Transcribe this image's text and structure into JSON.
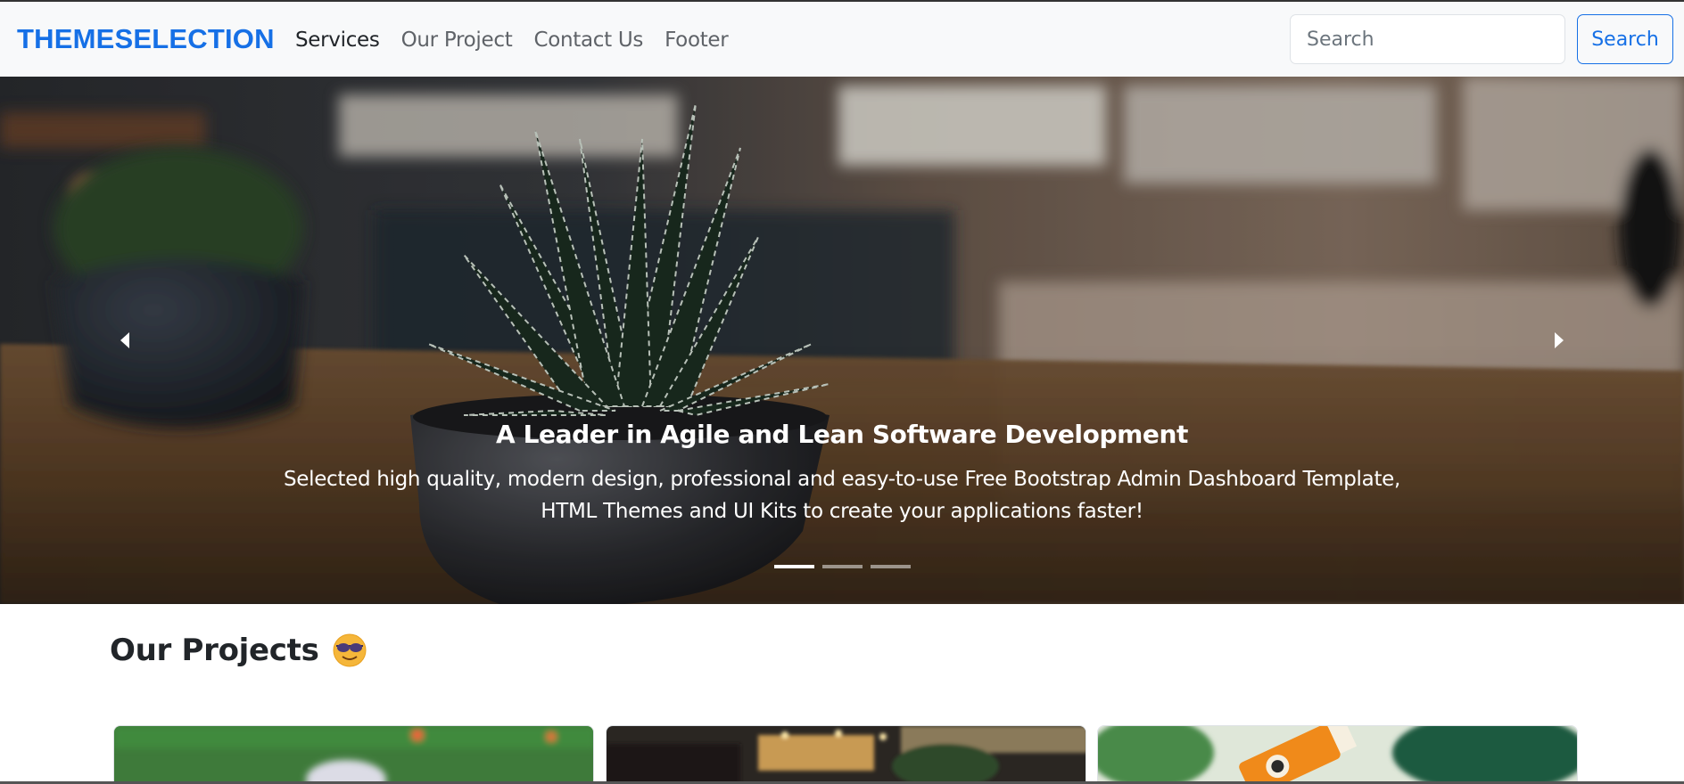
{
  "navbar": {
    "brand": "THEMESELECTION",
    "links": [
      {
        "label": "Services",
        "active": true
      },
      {
        "label": "Our Project",
        "active": false
      },
      {
        "label": "Contact Us",
        "active": false
      },
      {
        "label": "Footer",
        "active": false
      }
    ],
    "search": {
      "placeholder": "Search",
      "value": "",
      "button_label": "Search"
    }
  },
  "carousel": {
    "caption_title": "A Leader in Agile and Lean Software Development",
    "caption_text": "Selected high quality, modern design, professional and easy-to-use Free Bootstrap Admin Dashboard Template, HTML Themes and UI Kits to create your applications faster!",
    "slide_count": 3,
    "active_index": 0,
    "prev_icon": "caret-left-icon",
    "next_icon": "caret-right-icon"
  },
  "projects": {
    "title": "Our Projects",
    "emoji": "sunglasses-smiley-icon",
    "cards": [
      {
        "image": "soccer-field-image"
      },
      {
        "image": "cafe-interior-image"
      },
      {
        "image": "plant-and-drink-image"
      }
    ]
  },
  "colors": {
    "brand": "#1670e6",
    "navbar_bg": "#f8f9fa",
    "text": "#212529",
    "muted": "#5f6368"
  }
}
